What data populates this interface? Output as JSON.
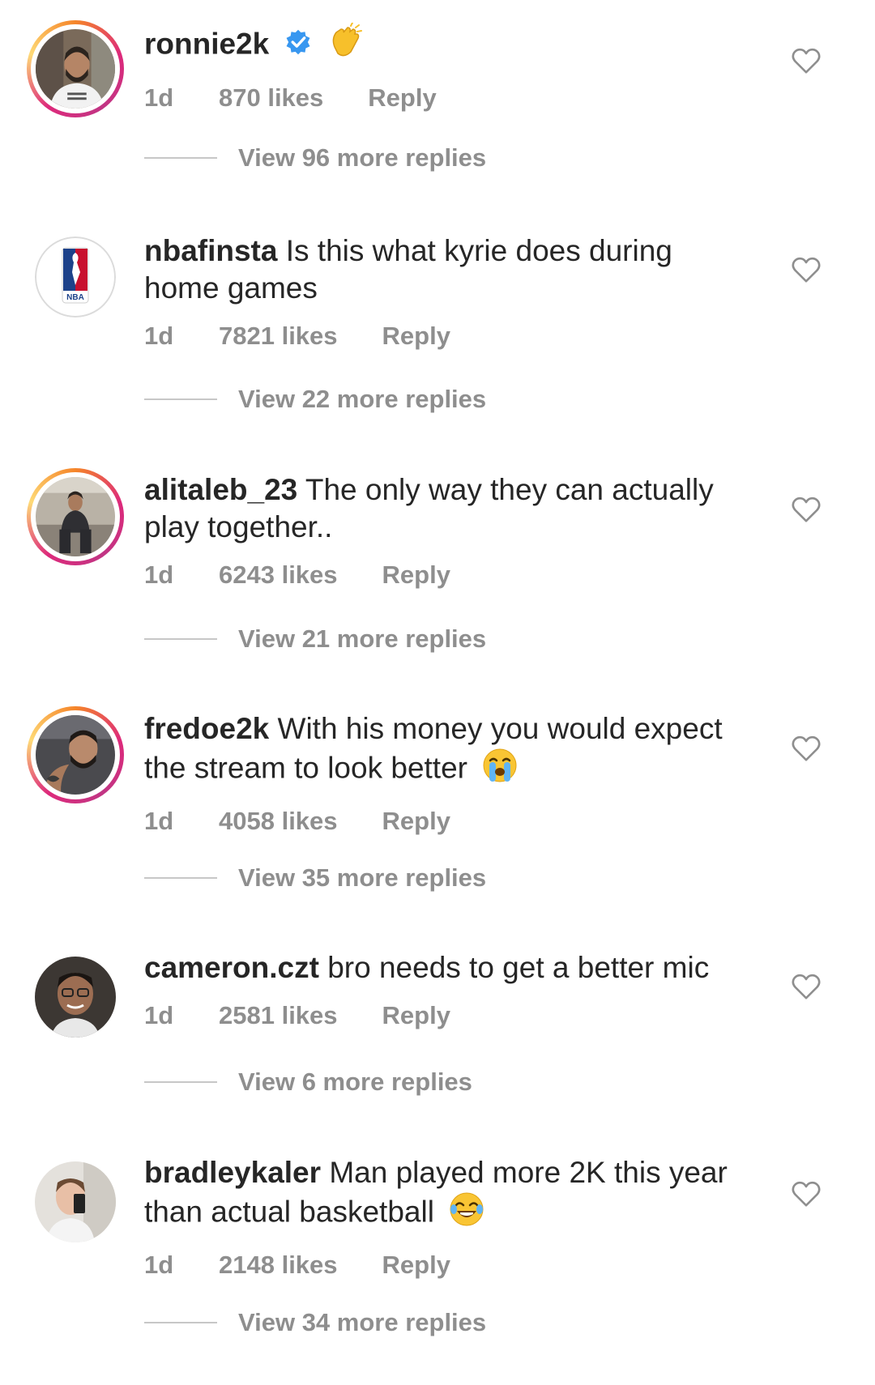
{
  "comments": [
    {
      "username": "ronnie2k",
      "text": "",
      "verified": true,
      "emoji": "clapping-hands",
      "time": "1d",
      "likes": "870 likes",
      "reply": "Reply",
      "view_replies": "View 96 more replies",
      "avatar": "photo",
      "story_ring": true
    },
    {
      "username": "nbafinsta",
      "text": "Is this what kyrie does during",
      "text2": "home games",
      "time": "1d",
      "likes": "7821 likes",
      "reply": "Reply",
      "view_replies": "View 22 more replies",
      "avatar": "nba-logo",
      "logo_text": "NBA",
      "story_ring": false
    },
    {
      "username": "alitaleb_23",
      "text": "The only way they can actually",
      "text2": "play together..",
      "time": "1d",
      "likes": "6243 likes",
      "reply": "Reply",
      "view_replies": "View 21 more replies",
      "avatar": "photo",
      "story_ring": true
    },
    {
      "username": "fredoe2k",
      "text": "With his money you would expect",
      "text2": "the stream to look better",
      "emoji": "loudly-crying-face",
      "time": "1d",
      "likes": "4058 likes",
      "reply": "Reply",
      "view_replies": "View 35 more replies",
      "avatar": "photo",
      "story_ring": true
    },
    {
      "username": "cameron.czt",
      "text": "bro needs to get a better mic",
      "time": "1d",
      "likes": "2581 likes",
      "reply": "Reply",
      "view_replies": "View 6 more replies",
      "avatar": "photo",
      "story_ring": false
    },
    {
      "username": "bradleykaler",
      "text": "Man played more 2K this year",
      "text2": "than actual basketball",
      "emoji": "face-with-tears-of-joy",
      "time": "1d",
      "likes": "2148 likes",
      "reply": "Reply",
      "view_replies": "View 34 more replies",
      "avatar": "photo",
      "story_ring": false
    }
  ],
  "icons": {
    "like": "heart-outline-icon",
    "verified": "verified-badge-icon"
  },
  "colors": {
    "text": "#262626",
    "meta": "#8e8e8e",
    "verified": "#3897f0",
    "divider": "#c7c7c7"
  }
}
